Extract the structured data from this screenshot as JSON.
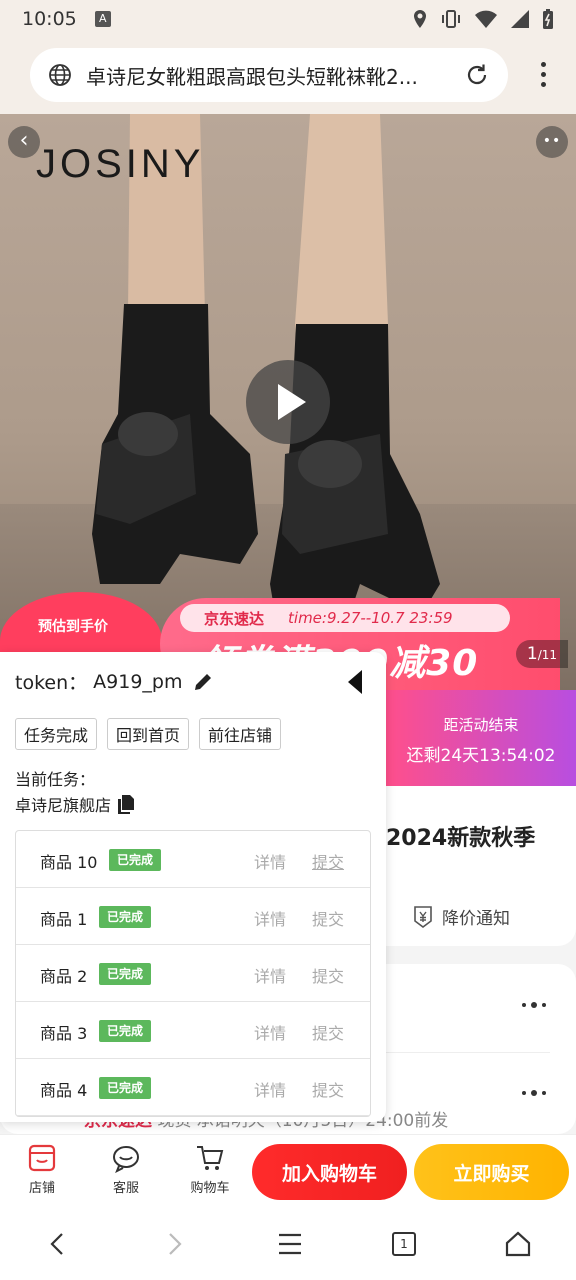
{
  "status_bar": {
    "time": "10:05",
    "notification_glyph": "A"
  },
  "url_bar": {
    "title": "卓诗尼女靴粗跟高跟包头短靴袜靴2..."
  },
  "hero": {
    "brand": "JOSINY",
    "promo_express": "京东速达",
    "promo_time": "time:9.27--10.7 23:59",
    "promo_coupon": "领券满300减30",
    "heart_label": "预估到手价",
    "counter_current": "1",
    "counter_total": "/11"
  },
  "countdown": {
    "label": "距活动结束",
    "value": "还剩24天13:54:02"
  },
  "product": {
    "title_fragment": "2024新款秋季",
    "price_alert": "降价通知"
  },
  "express_line": {
    "prefix": "京东速达",
    "text": "现货 承诺明天（10月5日）24:00前发"
  },
  "action_bar": {
    "store": "店铺",
    "service": "客服",
    "cart": "购物车",
    "add_to_cart": "加入购物车",
    "buy_now": "立即购买"
  },
  "panel": {
    "token_label": "token：",
    "token_value": "A919_pm",
    "buttons": [
      "任务完成",
      "回到首页",
      "前往店铺"
    ],
    "current_task_label": "当前任务：",
    "store_name": "卓诗尼旗舰店",
    "tasks": [
      {
        "name": "商品 10",
        "status": "已完成",
        "detail": "详情",
        "submit": "提交"
      },
      {
        "name": "商品 1",
        "status": "已完成",
        "detail": "详情",
        "submit": "提交"
      },
      {
        "name": "商品 2",
        "status": "已完成",
        "detail": "详情",
        "submit": "提交"
      },
      {
        "name": "商品 3",
        "status": "已完成",
        "detail": "详情",
        "submit": "提交"
      },
      {
        "name": "商品 4",
        "status": "已完成",
        "detail": "详情",
        "submit": "提交"
      }
    ]
  },
  "colors": {
    "accent_red": "#f02020",
    "accent_yellow": "#ffb300",
    "status_green": "#5cb85c",
    "promo_pink": "#ff4d6d"
  },
  "nav": {
    "tab_count": "1"
  }
}
